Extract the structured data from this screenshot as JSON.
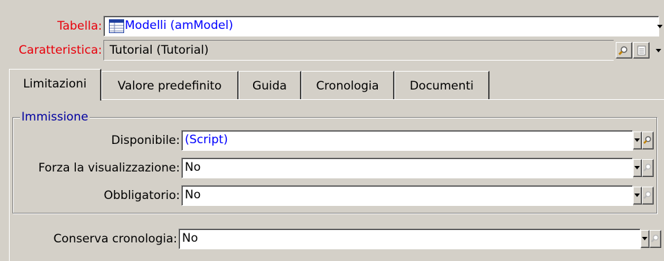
{
  "header": {
    "table_label": "Tabella:",
    "table_value": "Modelli (amModel)",
    "feature_label": "Caratteristica:",
    "feature_value": "Tutorial (Tutorial)"
  },
  "tabs": [
    {
      "label": "Limitazioni",
      "active": true
    },
    {
      "label": "Valore predefinito",
      "active": false
    },
    {
      "label": "Guida",
      "active": false
    },
    {
      "label": "Cronologia",
      "active": false
    },
    {
      "label": "Documenti",
      "active": false
    }
  ],
  "entry_group": {
    "title": "Immissione",
    "rows": [
      {
        "label": "Disponibile:",
        "value": "(Script)",
        "lookup_enabled": true
      },
      {
        "label": "Forza la visualizzazione:",
        "value": "No",
        "lookup_enabled": false
      },
      {
        "label": "Obbligatorio:",
        "value": "No",
        "lookup_enabled": false
      }
    ]
  },
  "history": {
    "label": "Conserva cronologia:",
    "value": "No",
    "lookup_enabled": false
  },
  "icons": [
    "table-icon",
    "magnifier-icon",
    "details-icon",
    "dropdown-arrow-icon"
  ],
  "colors": {
    "required_label": "#e8000b",
    "script_value": "#0000ff",
    "background": "#d4d0c8"
  }
}
